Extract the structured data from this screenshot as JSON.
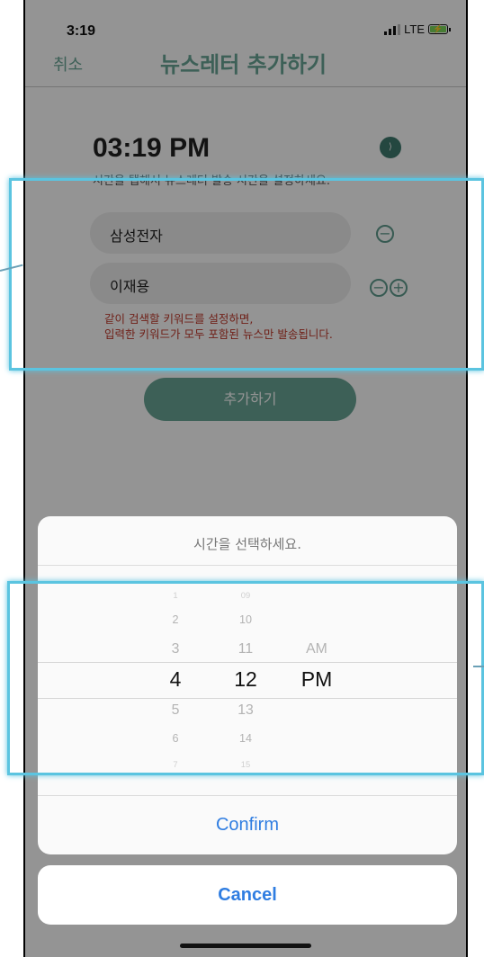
{
  "status_bar": {
    "time": "3:19",
    "network": "LTE"
  },
  "nav": {
    "cancel_label": "취소",
    "title": "뉴스레터 추가하기"
  },
  "form": {
    "time_value": "03:19 PM",
    "time_hint": "시간을 탭해서 뉴스레터 발송 시간을 설정하세요.",
    "keywords": [
      "삼성전자",
      "이재용"
    ],
    "warning_line1": "같이 검색할 키워드를 설정하면,",
    "warning_line2": "입력한 키워드가 모두 포함된 뉴스만 발송됩니다.",
    "add_label": "추가하기"
  },
  "sheet": {
    "title": "시간을 선택하세요.",
    "hours": [
      "1",
      "2",
      "3",
      "4",
      "5",
      "6",
      "7"
    ],
    "minutes": [
      "09",
      "10",
      "11",
      "12",
      "13",
      "14",
      "15"
    ],
    "ampm": [
      "AM",
      "PM"
    ],
    "selected": {
      "hour": "4",
      "minute": "12",
      "ampm": "PM"
    },
    "confirm_label": "Confirm",
    "cancel_label": "Cancel"
  },
  "colors": {
    "accent": "#6aa596",
    "ios_blue": "#2f7de1",
    "warning": "#c0392b",
    "highlight": "#5bc4e0"
  }
}
